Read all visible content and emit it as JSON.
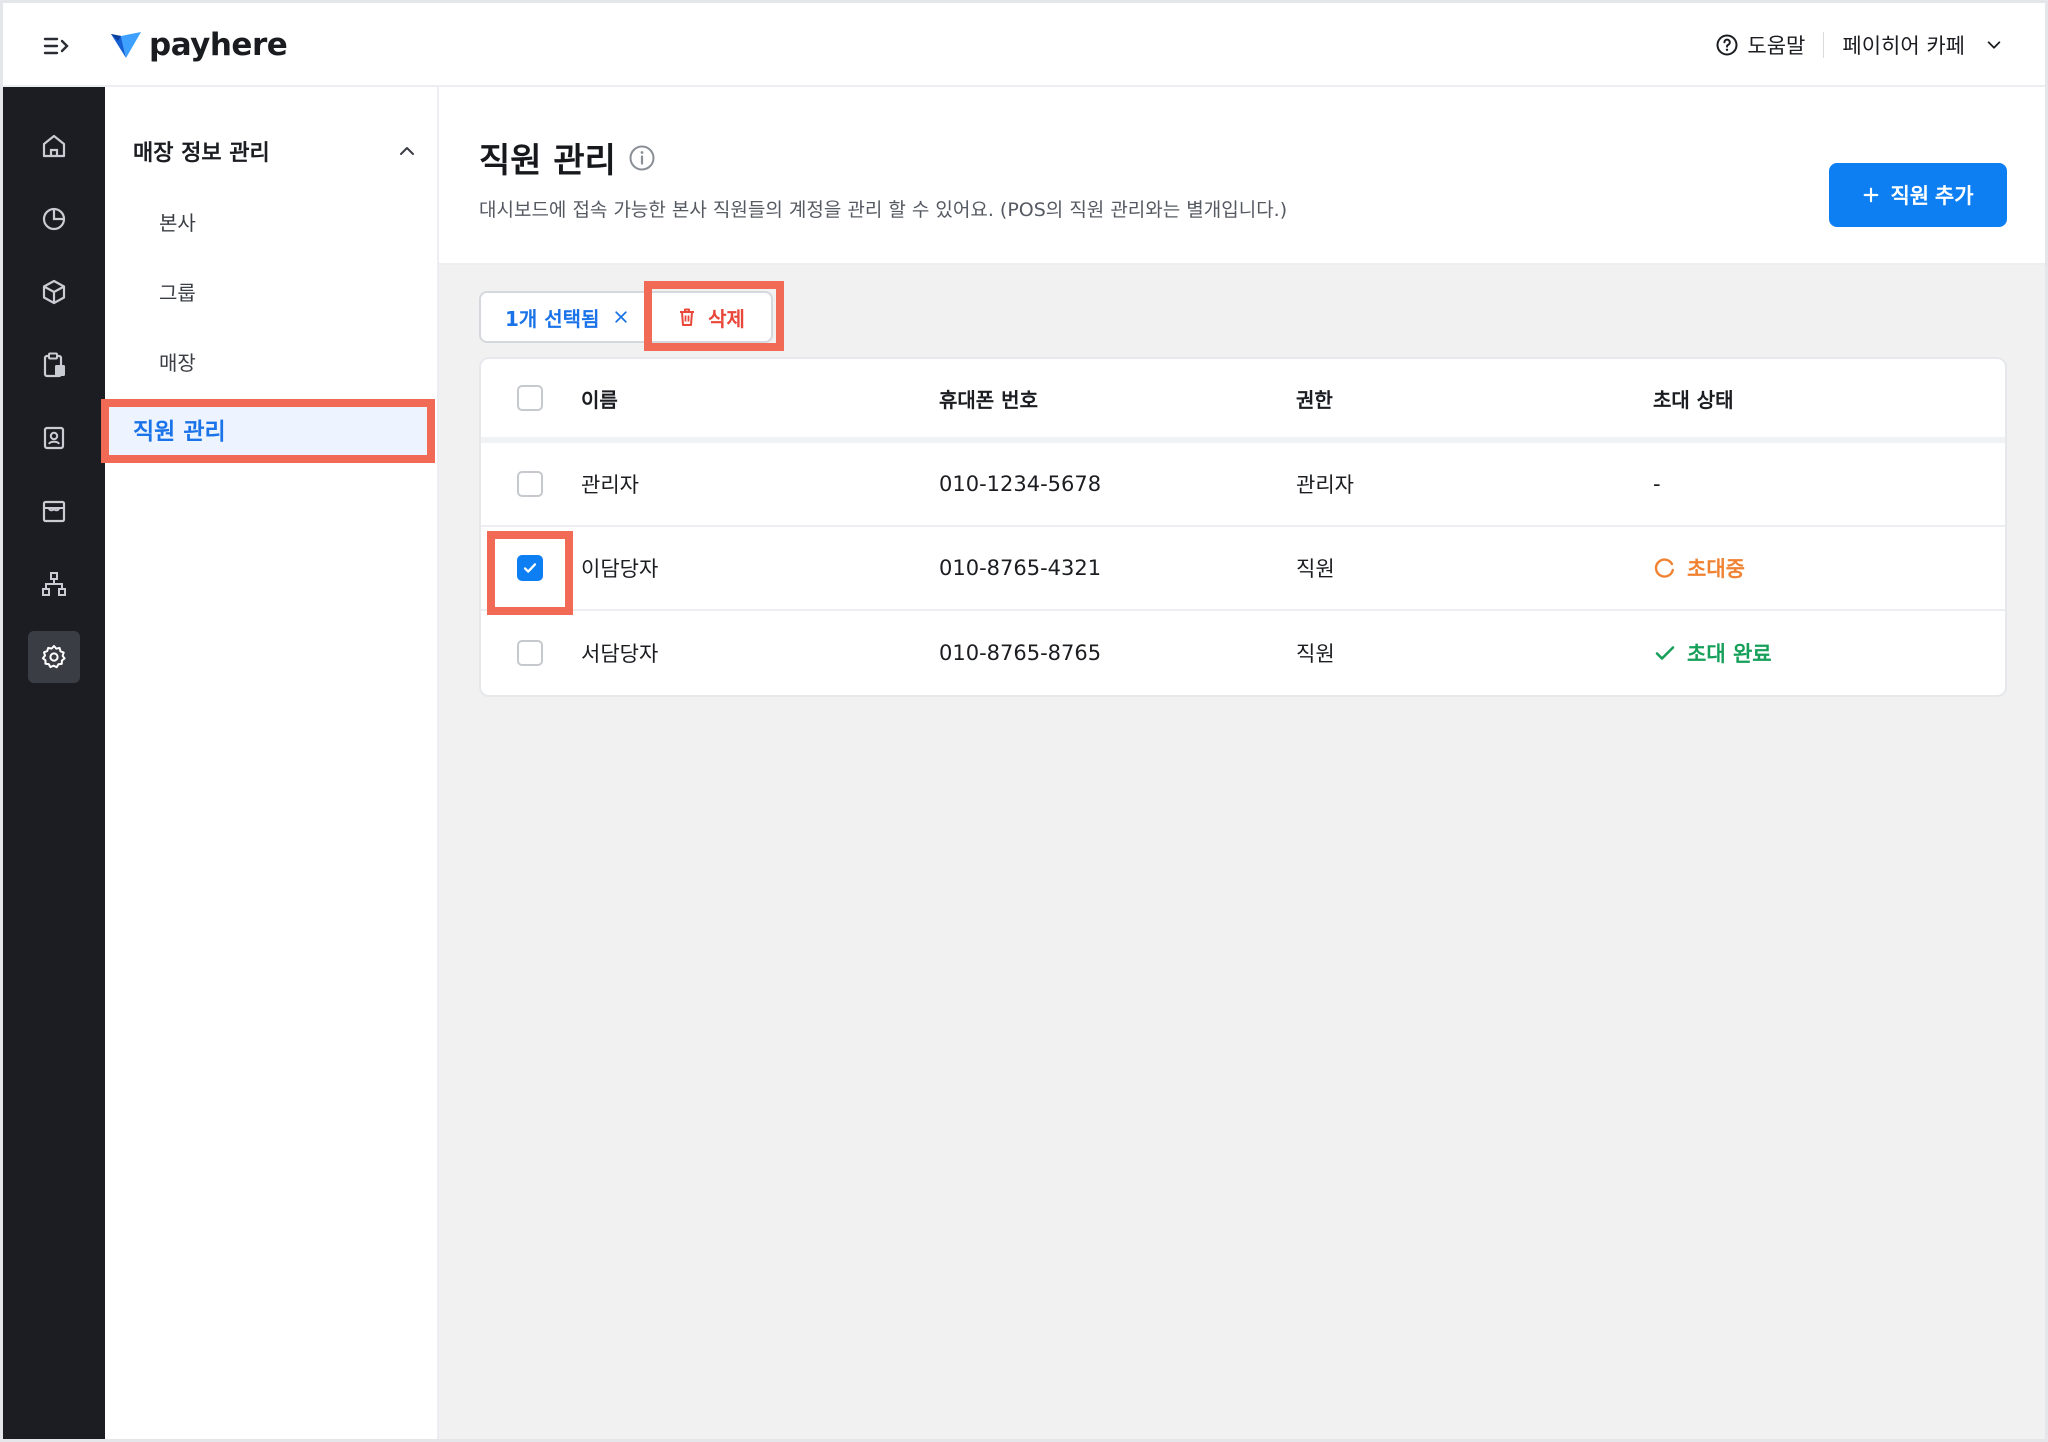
{
  "app": {
    "brand": "payhere"
  },
  "header": {
    "help_label": "도움말",
    "store_name": "페이히어 카페"
  },
  "rail": {
    "items": [
      {
        "icon": "home-icon"
      },
      {
        "icon": "chart-pie-icon"
      },
      {
        "icon": "box-icon"
      },
      {
        "icon": "clipboard-icon"
      },
      {
        "icon": "contact-card-icon"
      },
      {
        "icon": "store-icon"
      },
      {
        "icon": "org-chart-icon"
      },
      {
        "icon": "settings-gear-icon",
        "active": true
      }
    ]
  },
  "subnav": {
    "group_label": "매장 정보 관리",
    "items": [
      "본사",
      "그룹",
      "매장"
    ],
    "active_label": "직원 관리"
  },
  "page": {
    "title": "직원 관리",
    "description": "대시보드에 접속 가능한 본사 직원들의 계정을 관리 할 수 있어요. (POS의 직원 관리와는 별개입니다.)",
    "add_button": "직원 추가"
  },
  "selection": {
    "count_label": "1개 선택됨",
    "delete_label": "삭제"
  },
  "table": {
    "headers": {
      "name": "이름",
      "phone": "휴대폰 번호",
      "role": "권한",
      "status": "초대 상태"
    },
    "rows": [
      {
        "name": "관리자",
        "phone": "010-1234-5678",
        "role": "관리자",
        "status": "-",
        "checked": false
      },
      {
        "name": "이담당자",
        "phone": "010-8765-4321",
        "role": "직원",
        "status": "초대중",
        "checked": true
      },
      {
        "name": "서담당자",
        "phone": "010-8765-8765",
        "role": "직원",
        "status": "초대 완료",
        "checked": false
      }
    ]
  },
  "colors": {
    "accent": "#0d7ff2",
    "rail_bg": "#1b1d22",
    "highlight": "#f06a55",
    "danger": "#e8473a",
    "pending": "#f08232",
    "done": "#16a05a"
  }
}
